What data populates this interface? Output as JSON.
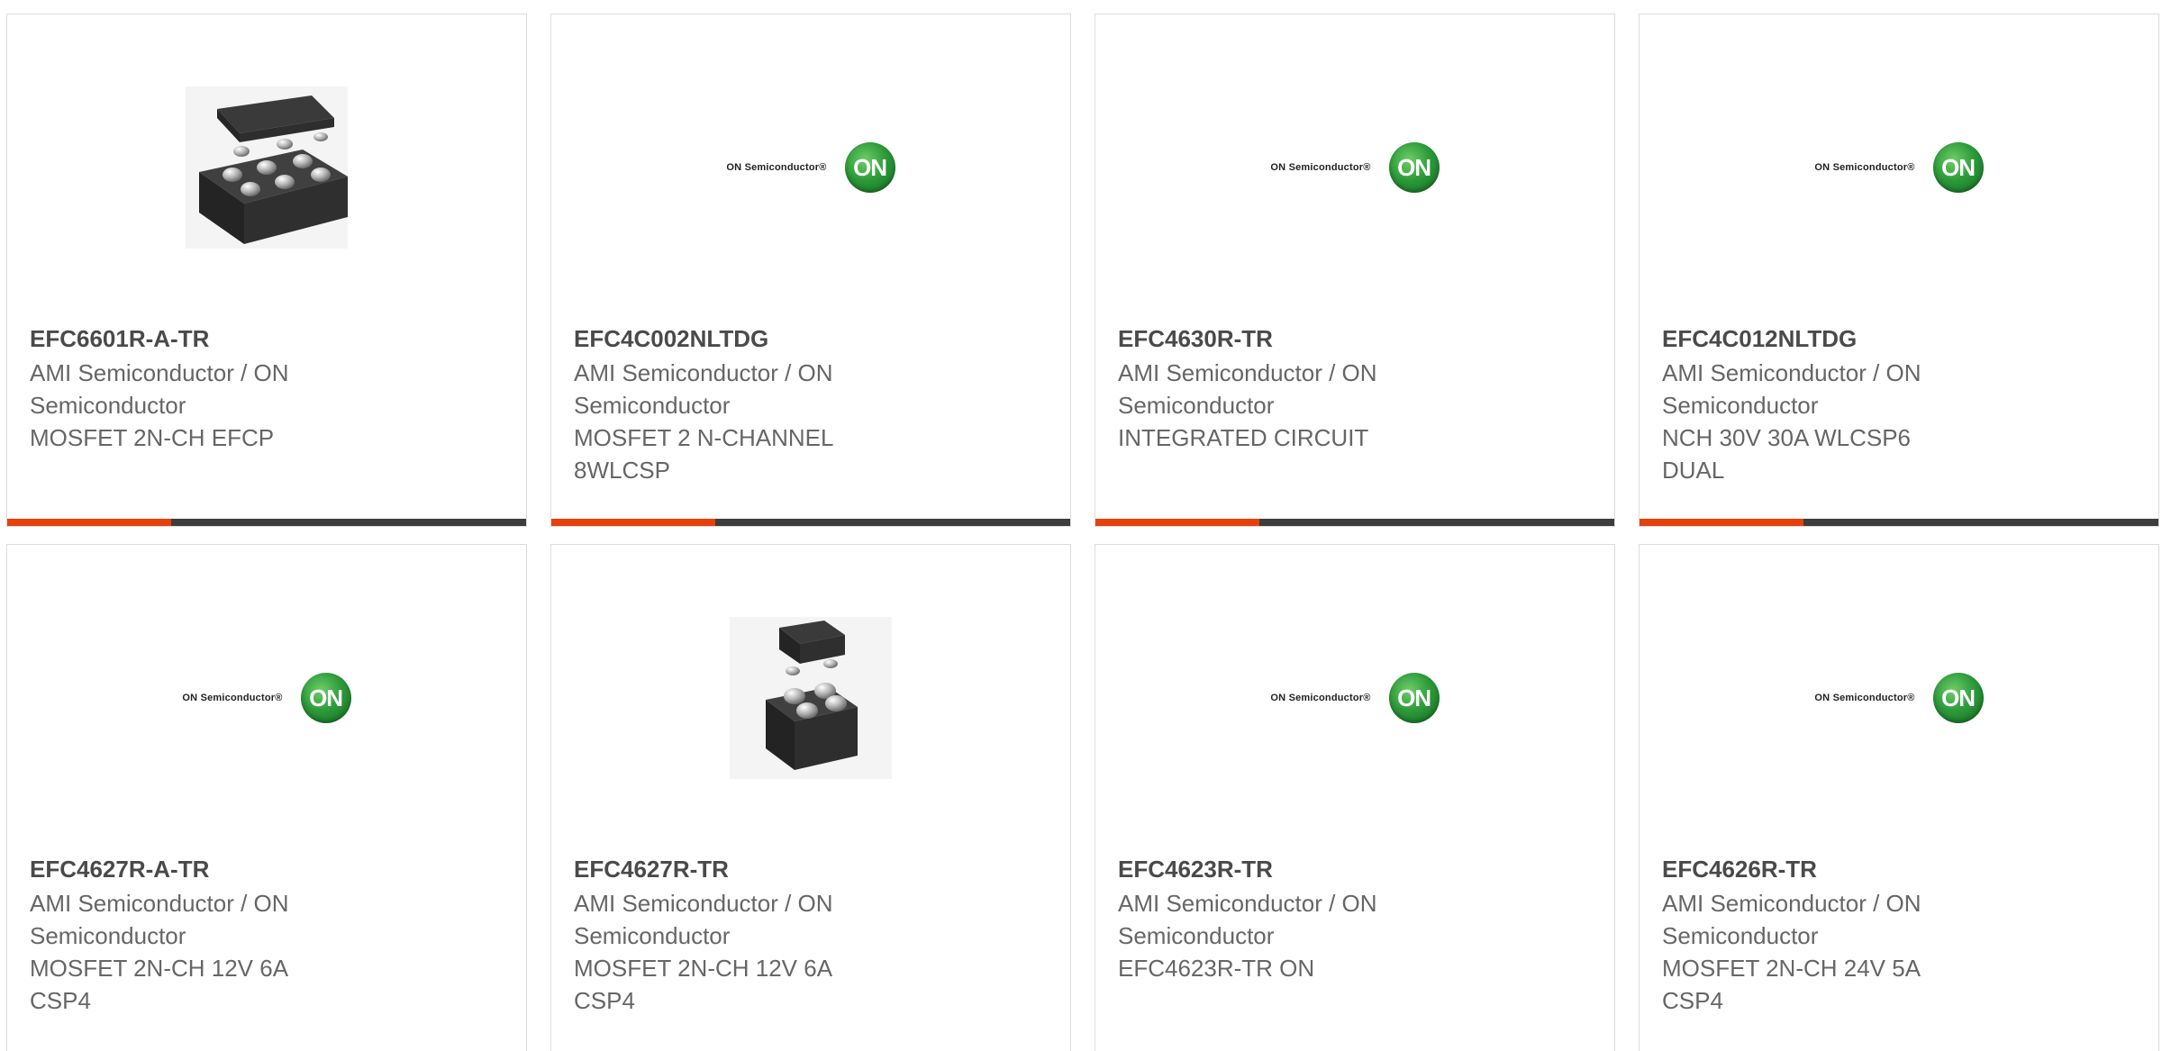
{
  "colors": {
    "accent": "#e6410d",
    "bar_dark": "#3d3d3d",
    "part_text": "#4a4a4a",
    "body_text": "#666666",
    "border": "#dcdcdc"
  },
  "cards": [
    {
      "part": "EFC6601R-A-TR",
      "manufacturer": "AMI Semiconductor / ON Semiconductor",
      "description": "MOSFET 2N-CH EFCP",
      "image": "chip-6ball-icon"
    },
    {
      "part": "EFC4C002NLTDG",
      "manufacturer": "AMI Semiconductor / ON Semiconductor",
      "description": "MOSFET 2 N-CHANNEL 8WLCSP",
      "image": "on-semiconductor-logo",
      "logo_text": "ON Semiconductor®",
      "logo_badge": "ON"
    },
    {
      "part": "EFC4630R-TR",
      "manufacturer": "AMI Semiconductor / ON Semiconductor",
      "description": "INTEGRATED CIRCUIT",
      "image": "on-semiconductor-logo",
      "logo_text": "ON Semiconductor®",
      "logo_badge": "ON"
    },
    {
      "part": "EFC4C012NLTDG",
      "manufacturer": "AMI Semiconductor / ON Semiconductor",
      "description": "NCH 30V 30A WLCSP6 DUAL",
      "image": "on-semiconductor-logo",
      "logo_text": "ON Semiconductor®",
      "logo_badge": "ON"
    },
    {
      "part": "EFC4627R-A-TR",
      "manufacturer": "AMI Semiconductor / ON Semiconductor",
      "description": "MOSFET 2N-CH 12V 6A CSP4",
      "image": "on-semiconductor-logo",
      "logo_text": "ON Semiconductor®",
      "logo_badge": "ON"
    },
    {
      "part": "EFC4627R-TR",
      "manufacturer": "AMI Semiconductor / ON Semiconductor",
      "description": "MOSFET 2N-CH 12V 6A CSP4",
      "image": "chip-4ball-icon"
    },
    {
      "part": "EFC4623R-TR",
      "manufacturer": "AMI Semiconductor / ON Semiconductor",
      "description": "EFC4623R-TR ON",
      "image": "on-semiconductor-logo",
      "logo_text": "ON Semiconductor®",
      "logo_badge": "ON"
    },
    {
      "part": "EFC4626R-TR",
      "manufacturer": "AMI Semiconductor / ON Semiconductor",
      "description": "MOSFET 2N-CH 24V 5A CSP4",
      "image": "on-semiconductor-logo",
      "logo_text": "ON Semiconductor®",
      "logo_badge": "ON"
    }
  ]
}
